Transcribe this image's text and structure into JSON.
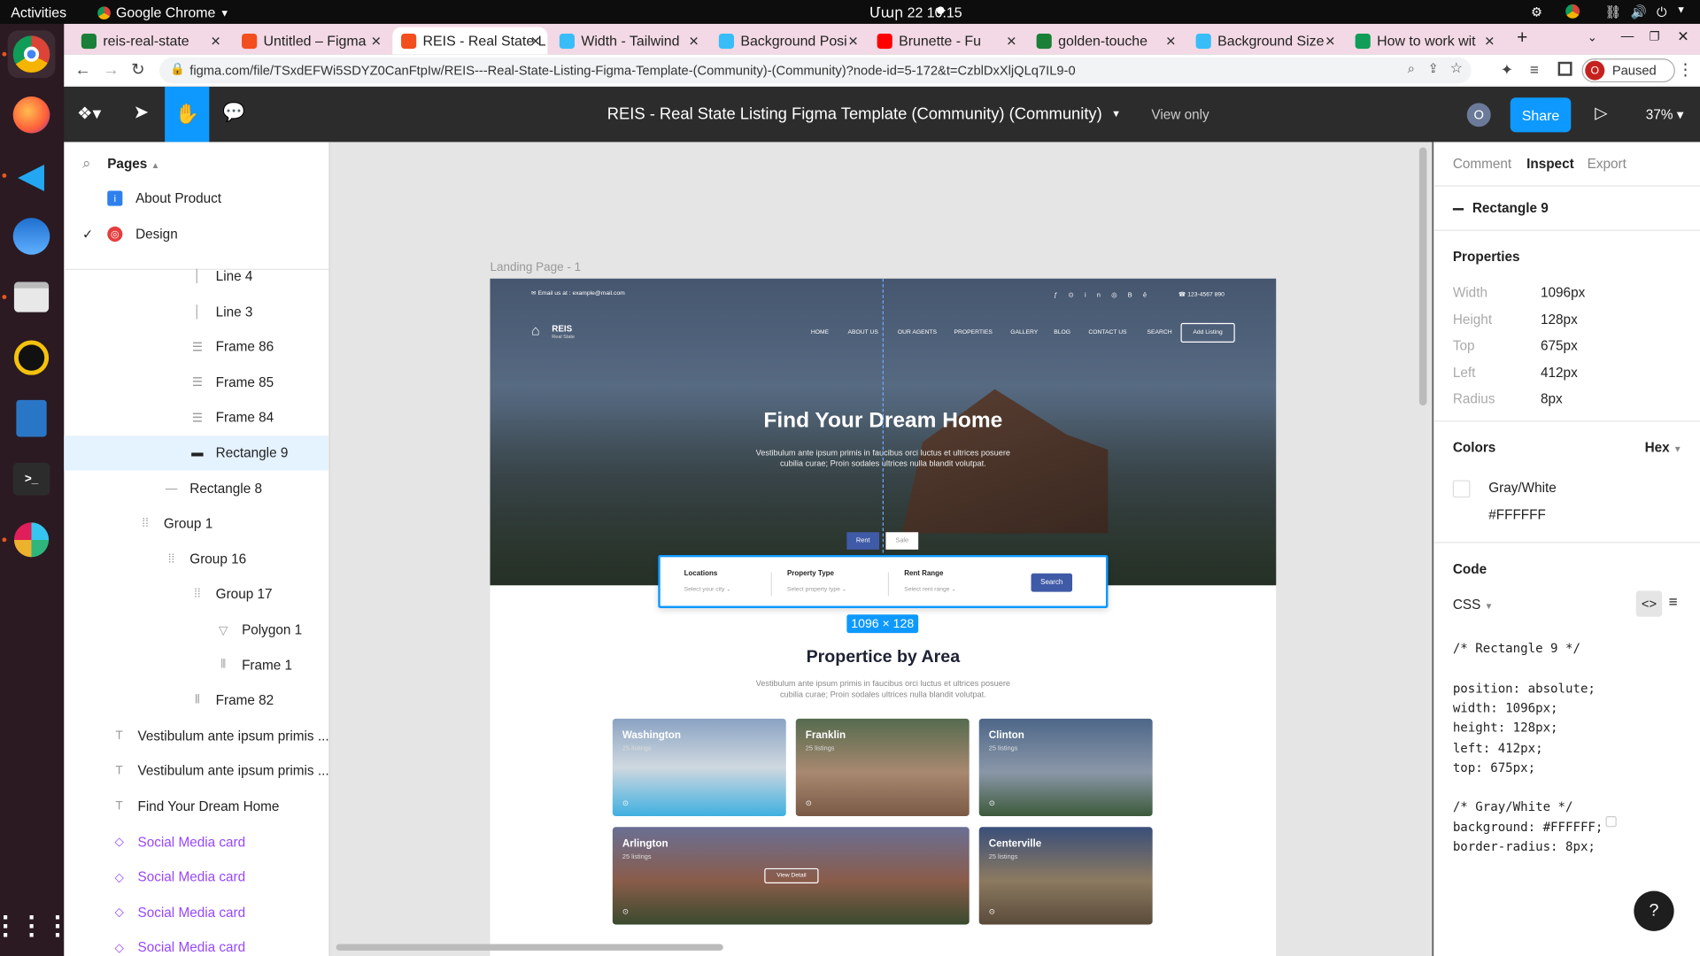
{
  "os": {
    "activities": "Activities",
    "app_menu": "Google Chrome",
    "clock": "Մար 22  10:15"
  },
  "tabs": [
    {
      "label": "reis-real-state",
      "icon": "vercel",
      "color": "#1a7f37"
    },
    {
      "label": "Untitled – Figma",
      "icon": "figma",
      "color": "#f24e1e"
    },
    {
      "label": "REIS - Real State L",
      "icon": "figma",
      "color": "#f24e1e",
      "active": true
    },
    {
      "label": "Width - Tailwind",
      "icon": "tailwind",
      "color": "#38bdf8"
    },
    {
      "label": "Background Posi",
      "icon": "tailwind",
      "color": "#38bdf8"
    },
    {
      "label": "Brunette - Fu",
      "icon": "youtube",
      "color": "#ff0000"
    },
    {
      "label": "golden-touche",
      "icon": "vercel",
      "color": "#1a7f37"
    },
    {
      "label": "Background Size",
      "icon": "tailwind",
      "color": "#38bdf8"
    },
    {
      "label": "How to work wit",
      "icon": "generic",
      "color": "#0f9d58"
    }
  ],
  "address": {
    "url": "figma.com/file/TSxdEFWi5SDYZ0CanFtpIw/REIS---Real-State-Listing-Figma-Template-(Community)-(Community)?node-id=5-172&t=CzblDxXljQLq7IL9-0",
    "profile_letter": "O",
    "paused": "Paused"
  },
  "figma": {
    "file_title": "REIS - Real State Listing Figma Template (Community) (Community)",
    "view_only": "View only",
    "avatar": "O",
    "share": "Share",
    "zoom": "37%"
  },
  "layers": {
    "pages_label": "Pages",
    "pages": [
      {
        "label": "About Product",
        "icon": "info-icon"
      },
      {
        "label": "Design",
        "icon": "target-icon",
        "checked": true
      }
    ],
    "items": [
      {
        "label": "Line 4",
        "kind": "line-v",
        "indent": 3
      },
      {
        "label": "Line 3",
        "kind": "line-v",
        "indent": 3
      },
      {
        "label": "Frame 86",
        "kind": "frame-rows",
        "indent": 3
      },
      {
        "label": "Frame 85",
        "kind": "frame-rows",
        "indent": 3
      },
      {
        "label": "Frame 84",
        "kind": "frame-rows",
        "indent": 3
      },
      {
        "label": "Rectangle 9",
        "kind": "rect",
        "indent": 3,
        "selected": true
      },
      {
        "label": "Rectangle 8",
        "kind": "line-h",
        "indent": 2
      },
      {
        "label": "Group 1",
        "kind": "group",
        "indent": 1
      },
      {
        "label": "Group 16",
        "kind": "group",
        "indent": 2
      },
      {
        "label": "Group 17",
        "kind": "group",
        "indent": 3
      },
      {
        "label": "Polygon 1",
        "kind": "polygon",
        "indent": 4
      },
      {
        "label": "Frame 1",
        "kind": "frame-cols",
        "indent": 4
      },
      {
        "label": "Frame 82",
        "kind": "frame-cols",
        "indent": 3
      },
      {
        "label": "Vestibulum ante ipsum primis ...",
        "kind": "text",
        "indent": 0
      },
      {
        "label": "Vestibulum ante ipsum primis ...",
        "kind": "text",
        "indent": 0
      },
      {
        "label": "Find Your Dream Home",
        "kind": "text",
        "indent": 0
      },
      {
        "label": "Social Media card",
        "kind": "component",
        "indent": 0
      },
      {
        "label": "Social Media card",
        "kind": "component",
        "indent": 0
      },
      {
        "label": "Social Media card",
        "kind": "component",
        "indent": 0
      },
      {
        "label": "Social Media card",
        "kind": "component",
        "indent": 0
      }
    ]
  },
  "canvas": {
    "frame_label": "Landing Page - 1",
    "size_badge": "1096 × 128",
    "mock": {
      "email": "Email us at : example@mail.com",
      "phone": "123-4567 890",
      "brand": "REIS",
      "brand_sub": "Real State",
      "nav": [
        "HOME",
        "ABOUT US",
        "OUR AGENTS",
        "PROPERTIES",
        "GALLERY",
        "BLOG",
        "CONTACT US",
        "SEARCH"
      ],
      "add_listing": "Add Listing",
      "hero_title": "Find Your Dream Home",
      "hero_sub1": "Vestibulum ante ipsum primis in faucibus orci luctus et ultrices posuere",
      "hero_sub2": "cubilia curae; Proin sodales ultrices nulla blandit volutpat.",
      "rent": "Rent",
      "sale": "Sale",
      "search_fields": [
        {
          "label": "Locations",
          "value": "Select your city"
        },
        {
          "label": "Property Type",
          "value": "Select property type"
        },
        {
          "label": "Rent Range",
          "value": "Select rent range"
        }
      ],
      "search_btn": "Search",
      "section_title": "Propertice by Area",
      "section_sub1": "Vestibulum ante ipsum primis in faucibus orci luctus et ultrices posuere",
      "section_sub2": "cubilia curae; Proin sodales ultrices nulla blandit volutpat.",
      "cards": [
        {
          "name": "Washington",
          "listings": "25 listings"
        },
        {
          "name": "Franklin",
          "listings": "25 listings"
        },
        {
          "name": "Clinton",
          "listings": "25 listings"
        },
        {
          "name": "Arlington",
          "listings": "25 listings",
          "cta": "View Detail"
        },
        {
          "name": "Centerville",
          "listings": "25 listings"
        }
      ]
    }
  },
  "inspect": {
    "tabs": [
      "Comment",
      "Inspect",
      "Export"
    ],
    "layer_name": "Rectangle 9",
    "properties_title": "Properties",
    "props": [
      {
        "k": "Width",
        "v": "1096px"
      },
      {
        "k": "Height",
        "v": "128px"
      },
      {
        "k": "Top",
        "v": "675px"
      },
      {
        "k": "Left",
        "v": "412px"
      },
      {
        "k": "Radius",
        "v": "8px"
      }
    ],
    "colors_title": "Colors",
    "color_format": "Hex",
    "color_name": "Gray/White",
    "color_hex": "#FFFFFF",
    "code_title": "Code",
    "code_lang": "CSS",
    "code_lines": [
      "/* Rectangle 9 */",
      "",
      "position: absolute;",
      "width: 1096px;",
      "height: 128px;",
      "left: 412px;",
      "top: 675px;",
      "",
      "/* Gray/White */",
      "background: #FFFFFF;",
      "border-radius: 8px;"
    ],
    "help": "?"
  }
}
